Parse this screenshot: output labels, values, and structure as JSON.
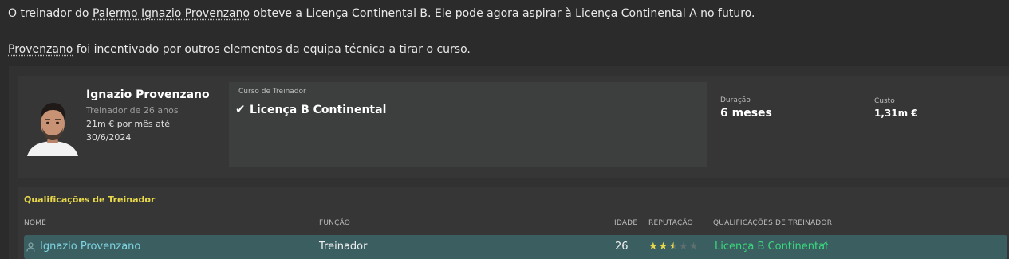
{
  "message": {
    "line1_pre": "O treinador do ",
    "line1_link": "Palermo Ignazio Provenzano",
    "line1_post": " obteve a Licença Continental B. Ele pode agora aspirar à Licença Continental A no futuro.",
    "line2_link": "Provenzano",
    "line2_post": " foi incentivado por outros elementos da equipa técnica a tirar o curso."
  },
  "person": {
    "name": "Ignazio Provenzano",
    "role_age": "Treinador de 26 anos",
    "wage": "21m € por mês até",
    "contract_end": "30/6/2024",
    "photo_icon": "person-photo"
  },
  "course": {
    "label": "Curso de Treinador",
    "value": "Licença B Continental",
    "check_icon": "check-icon"
  },
  "stats": {
    "duration_label": "Duração",
    "duration_value": "6 meses",
    "cost_label": "Custo",
    "cost_value": "1,31m €"
  },
  "qualifications": {
    "title": "Qualificações de Treinador",
    "columns": [
      "NOME",
      "FUNÇÃO",
      "IDADE",
      "REPUTAÇÃO",
      "QUALIFICAÇÕES DE TREINADOR"
    ],
    "rows": [
      {
        "name": "Ignazio Provenzano",
        "role": "Treinador",
        "age": "26",
        "reputation_stars": 2.5,
        "reputation_max": 5,
        "qualification": "Licença B Continental"
      }
    ]
  },
  "colors": {
    "background": "#2b2b2b",
    "panel": "#363636",
    "highlight_row": "#3b5e60",
    "accent_yellow": "#e8d84a",
    "accent_green": "#38d97d",
    "link_cyan": "#7fd6e4"
  }
}
